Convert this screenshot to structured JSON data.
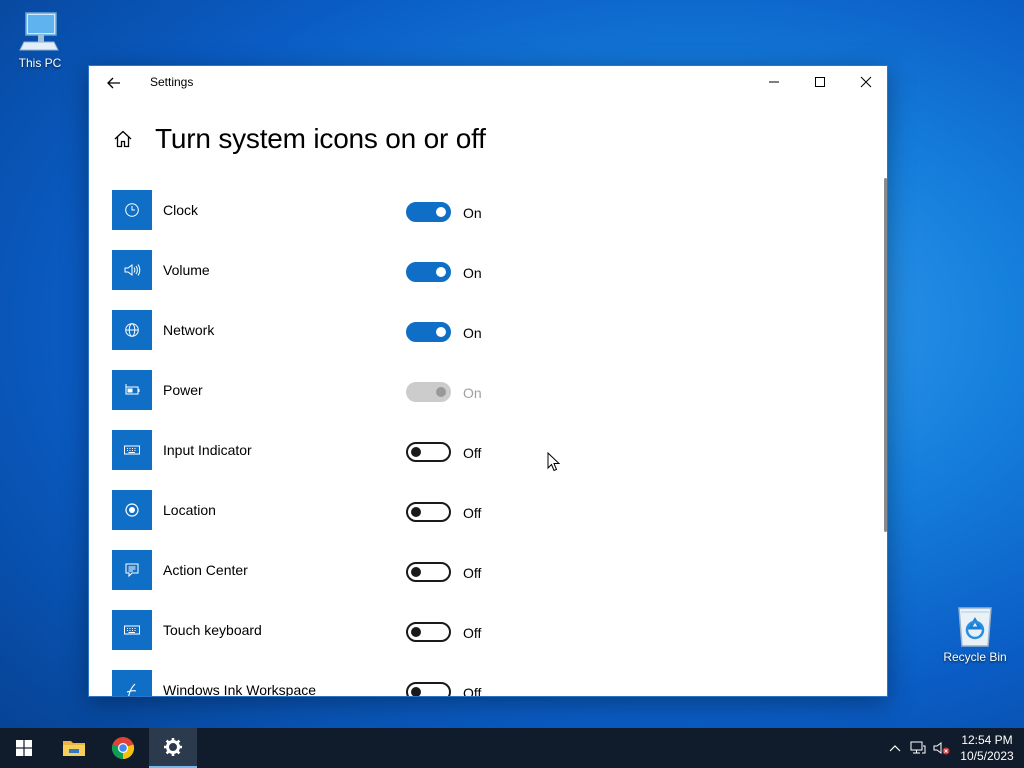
{
  "desktop": {
    "icons": [
      {
        "label": "This PC",
        "icon": "monitor-icon"
      },
      {
        "label": "Recycle Bin",
        "icon": "recycle-bin-icon"
      }
    ]
  },
  "window": {
    "title": "Settings",
    "page_title": "Turn system icons on or off",
    "items": [
      {
        "label": "Clock",
        "state": "On",
        "enabled": true,
        "icon": "clock-icon"
      },
      {
        "label": "Volume",
        "state": "On",
        "enabled": true,
        "icon": "speaker-icon"
      },
      {
        "label": "Network",
        "state": "On",
        "enabled": true,
        "icon": "globe-icon"
      },
      {
        "label": "Power",
        "state": "On",
        "enabled": false,
        "icon": "battery-icon"
      },
      {
        "label": "Input Indicator",
        "state": "Off",
        "enabled": true,
        "icon": "keyboard-icon"
      },
      {
        "label": "Location",
        "state": "Off",
        "enabled": true,
        "icon": "location-icon"
      },
      {
        "label": "Action Center",
        "state": "Off",
        "enabled": true,
        "icon": "action-center-icon"
      },
      {
        "label": "Touch keyboard",
        "state": "Off",
        "enabled": true,
        "icon": "keyboard-icon"
      },
      {
        "label": "Windows Ink Workspace",
        "state": "Off",
        "enabled": true,
        "icon": "pen-icon"
      }
    ]
  },
  "taskbar": {
    "time": "12:54 PM",
    "date": "10/5/2023"
  },
  "colors": {
    "accent": "#0f6fc6",
    "taskbar": "#101c2b"
  }
}
